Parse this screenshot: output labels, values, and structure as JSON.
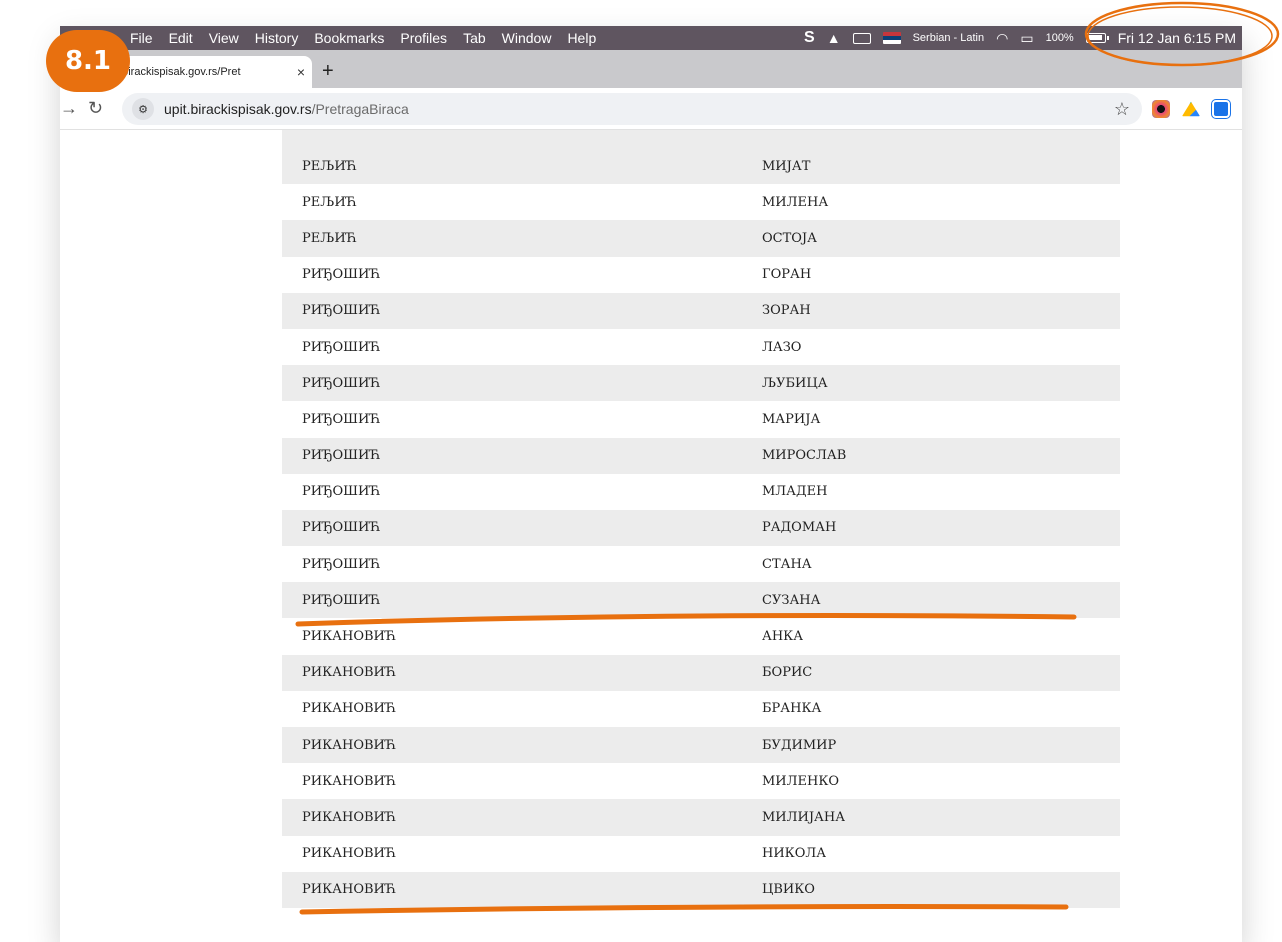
{
  "annotation": {
    "badge": "8.1",
    "color": "#e8700f"
  },
  "menubar": {
    "items": [
      "File",
      "Edit",
      "View",
      "History",
      "Bookmarks",
      "Profiles",
      "Tab",
      "Window",
      "Help"
    ],
    "status": {
      "language": "Serbian - Latin",
      "battery": "100%",
      "datetime": "Fri 12 Jan  6:15 PM"
    }
  },
  "tab": {
    "title": "upit.birackispisak.gov.rs/Pretr",
    "visible_title": "t.birackispisak.gov.rs/Pret",
    "close": "×",
    "new_tab": "+"
  },
  "toolbar": {
    "url_host": "upit.birackispisak.gov.rs",
    "url_path": "/PretragaBiraca",
    "icons": [
      "back-icon",
      "reload-icon",
      "site-settings-icon",
      "bookmark-star-icon",
      "extension-icons"
    ]
  },
  "table": {
    "rows": [
      [
        "РЕЉИЋ",
        "МИЈАТ"
      ],
      [
        "РЕЉИЋ",
        "МИЛЕНА"
      ],
      [
        "РЕЉИЋ",
        "ОСТОЈА"
      ],
      [
        "РИЂОШИЋ",
        "ГОРАН"
      ],
      [
        "РИЂОШИЋ",
        "ЗОРАН"
      ],
      [
        "РИЂОШИЋ",
        "ЛАЗО"
      ],
      [
        "РИЂОШИЋ",
        "ЉУБИЦА"
      ],
      [
        "РИЂОШИЋ",
        "МАРИЈА"
      ],
      [
        "РИЂОШИЋ",
        "МИРОСЛАВ"
      ],
      [
        "РИЂОШИЋ",
        "МЛАДЕН"
      ],
      [
        "РИЂОШИЋ",
        "РАДОМАН"
      ],
      [
        "РИЂОШИЋ",
        "СТАНА"
      ],
      [
        "РИЂОШИЋ",
        "СУЗАНА"
      ],
      [
        "РИКАНОВИЋ",
        "АНКА"
      ],
      [
        "РИКАНОВИЋ",
        "БОРИС"
      ],
      [
        "РИКАНОВИЋ",
        "БРАНКА"
      ],
      [
        "РИКАНОВИЋ",
        "БУДИМИР"
      ],
      [
        "РИКАНОВИЋ",
        "МИЛЕНКО"
      ],
      [
        "РИКАНОВИЋ",
        "МИЛИЈАНА"
      ],
      [
        "РИКАНОВИЋ",
        "НИКОЛА"
      ],
      [
        "РИКАНОВИЋ",
        "ЦВИКО"
      ]
    ]
  }
}
